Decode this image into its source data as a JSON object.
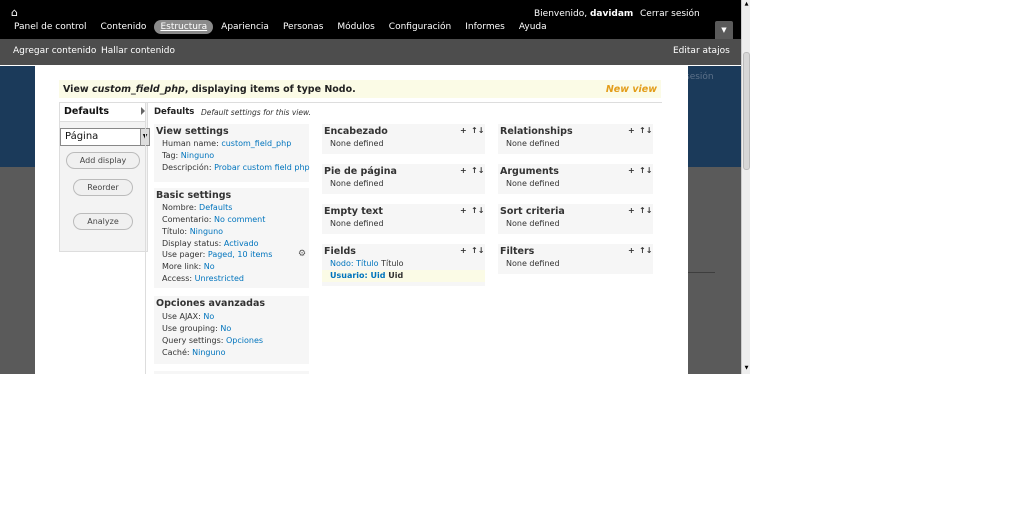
{
  "toolbar": {
    "nav": [
      "Panel de control",
      "Contenido",
      "Estructura",
      "Apariencia",
      "Personas",
      "Módulos",
      "Configuración",
      "Informes",
      "Ayuda"
    ],
    "welcome_prefix": "Bienvenido,",
    "username": "davidam",
    "logout": "Cerrar sesión"
  },
  "shortcuts": {
    "items": [
      "Agregar contenido",
      "Hallar contenido"
    ],
    "edit": "Editar atajos"
  },
  "background": {
    "sesion_text": "sesión"
  },
  "view": {
    "title_prefix": "View",
    "view_name": "custom_field_php",
    "title_suffix": ", displaying items of type Nodo.",
    "new_view": "New view"
  },
  "sidebar": {
    "tab_label": "Defaults",
    "display_select": "Página",
    "add_display": "Add display",
    "reorder": "Reorder",
    "analyze": "Analyze"
  },
  "main": {
    "label": "Defaults",
    "description": "Default settings for this view."
  },
  "view_settings": {
    "title": "View settings",
    "rows": [
      {
        "label": "Human name:",
        "value": "custom_field_php"
      },
      {
        "label": "Tag:",
        "value": "Ninguno"
      },
      {
        "label": "Descripción:",
        "value": "Probar custom field php"
      }
    ]
  },
  "basic_settings": {
    "title": "Basic settings",
    "rows": [
      {
        "label": "Nombre:",
        "value": "Defaults"
      },
      {
        "label": "Comentario:",
        "value": "No comment"
      },
      {
        "label": "Título:",
        "value": "Ninguno"
      },
      {
        "label": "Display status:",
        "value": "Activado"
      },
      {
        "label": "Use pager:",
        "value": "Paged, 10 items"
      },
      {
        "label": "More link:",
        "value": "No"
      },
      {
        "label": "Access:",
        "value": "Unrestricted"
      }
    ]
  },
  "advanced": {
    "title": "Opciones avanzadas",
    "rows": [
      {
        "label": "Use AJAX:",
        "value": "No"
      },
      {
        "label": "Use grouping:",
        "value": "No"
      },
      {
        "label": "Query settings:",
        "value": "Opciones"
      },
      {
        "label": "Caché:",
        "value": "Ninguno"
      }
    ]
  },
  "middle": {
    "header": {
      "title": "Encabezado",
      "empty": "None defined"
    },
    "footer": {
      "title": "Pie de página",
      "empty": "None defined"
    },
    "empty_text": {
      "title": "Empty text",
      "empty": "None defined"
    },
    "fields": {
      "title": "Fields",
      "rows": [
        {
          "link": "Nodo: Título",
          "label": "Título"
        },
        {
          "link": "Usuario: Uid",
          "label": "Uid"
        }
      ]
    }
  },
  "right": {
    "relationships": {
      "title": "Relationships",
      "empty": "None defined"
    },
    "arguments": {
      "title": "Arguments",
      "empty": "None defined"
    },
    "sort": {
      "title": "Sort criteria",
      "empty": "None defined"
    },
    "filters": {
      "title": "Filters",
      "empty": "None defined"
    }
  },
  "controls": {
    "add": "+",
    "rearrange": "↑↓"
  }
}
